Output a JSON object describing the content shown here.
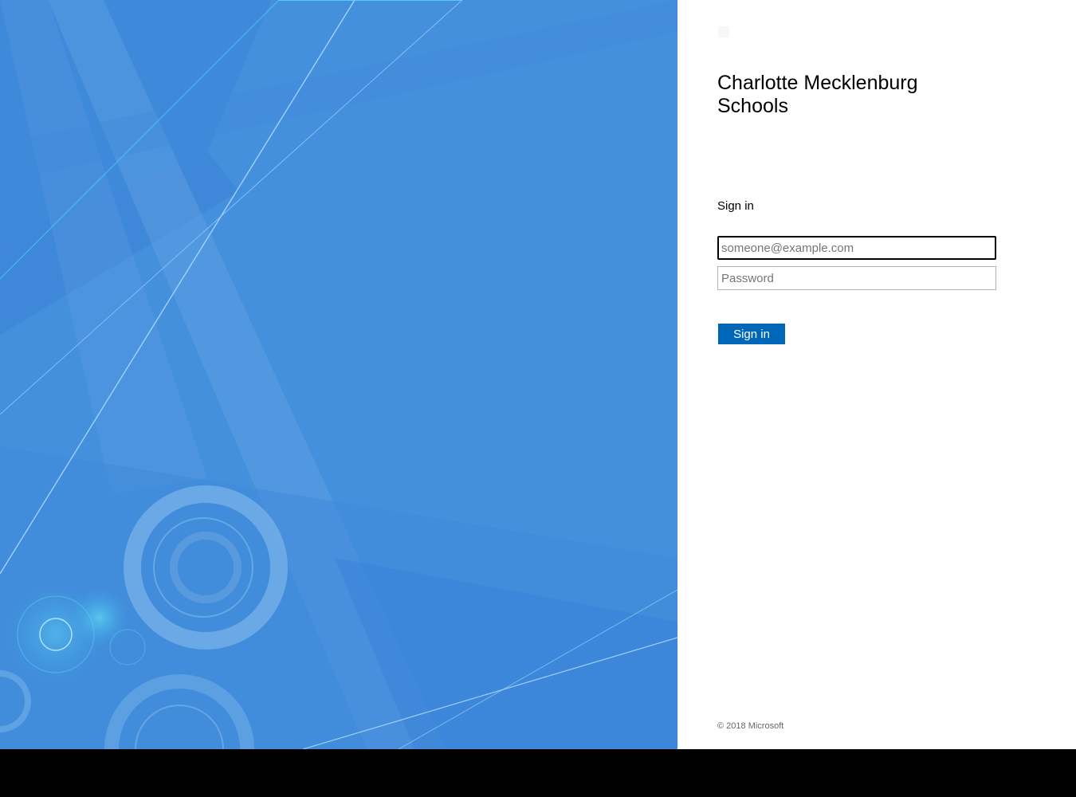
{
  "organization": {
    "name": "Charlotte Mecklenburg Schools"
  },
  "signin": {
    "heading": "Sign in",
    "email_placeholder": "someone@example.com",
    "email_value": "",
    "password_placeholder": "Password",
    "password_value": "",
    "submit_label": "Sign in"
  },
  "footer": {
    "copyright": "© 2018 Microsoft"
  },
  "colors": {
    "illustration_base": "#4590dd",
    "button_background": "#0067b8",
    "panel_background": "#ffffff",
    "letterbox": "#000000"
  },
  "icons": {
    "org_logo": "org-logo-icon"
  }
}
